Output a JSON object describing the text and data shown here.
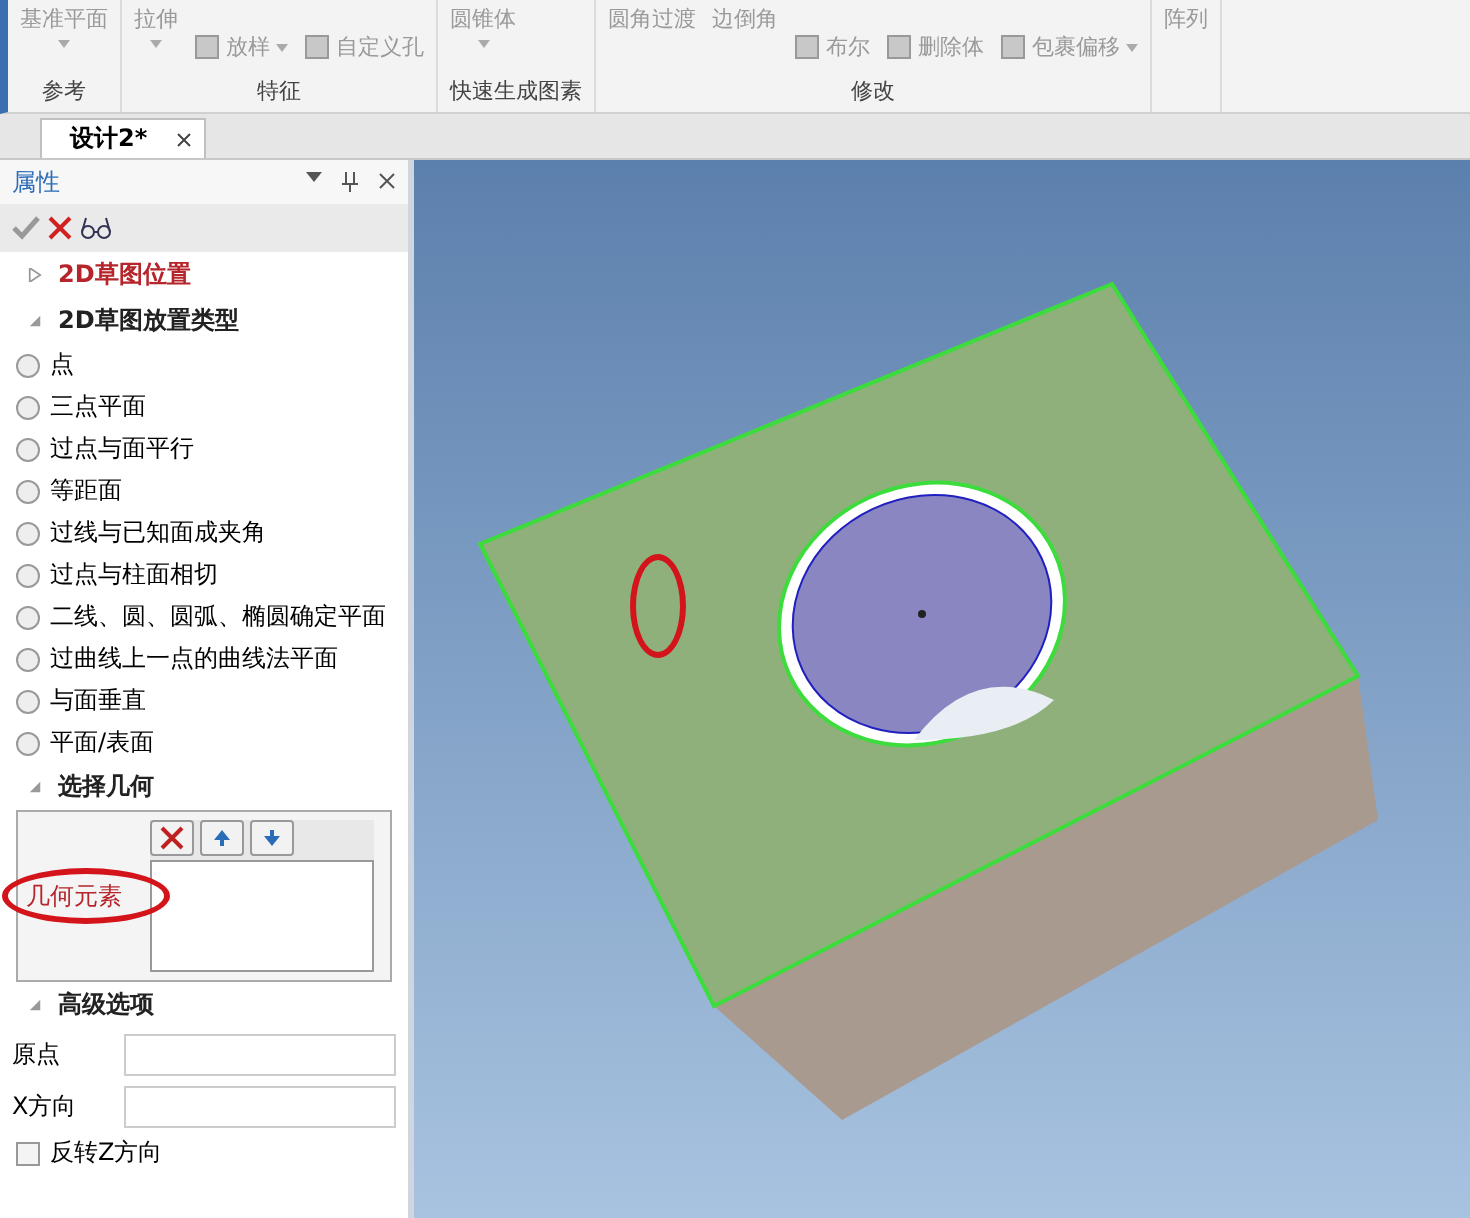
{
  "ribbon": {
    "groups": [
      {
        "label": "参考",
        "items": [
          {
            "label": "基准平面",
            "kind": "large"
          }
        ]
      },
      {
        "label": "特征",
        "items": [
          {
            "label": "拉伸",
            "kind": "large"
          },
          {
            "label": "放样",
            "kind": "small",
            "dropdown": true
          },
          {
            "label": "自定义孔",
            "kind": "small",
            "dropdown": false
          }
        ]
      },
      {
        "label": "快速生成图素",
        "items": [
          {
            "label": "圆锥体",
            "kind": "large"
          }
        ]
      },
      {
        "label": "修改",
        "items": [
          {
            "label": "圆角过渡",
            "kind": "text"
          },
          {
            "label": "边倒角",
            "kind": "text"
          },
          {
            "label": "布尔",
            "kind": "small",
            "dropdown": false
          },
          {
            "label": "删除体",
            "kind": "small",
            "dropdown": false
          },
          {
            "label": "包裹偏移",
            "kind": "small",
            "dropdown": true
          }
        ]
      },
      {
        "items": [
          {
            "label": "阵列",
            "kind": "text"
          }
        ]
      }
    ]
  },
  "tabs": [
    {
      "label": "设计2*",
      "selected": true
    }
  ],
  "panel": {
    "title": "属性",
    "sections": [
      {
        "title": "2D草图位置",
        "expanded": false,
        "required": true
      },
      {
        "title": "2D草图放置类型",
        "expanded": true,
        "required": false,
        "options": [
          {
            "label": "点",
            "selected": false
          },
          {
            "label": "三点平面",
            "selected": false
          },
          {
            "label": "过点与面平行",
            "selected": false
          },
          {
            "label": "等距面",
            "selected": false
          },
          {
            "label": "过线与已知面成夹角",
            "selected": false
          },
          {
            "label": "过点与柱面相切",
            "selected": false
          },
          {
            "label": "二线、圆、圆弧、椭圆确定平面",
            "selected": false
          },
          {
            "label": "过曲线上一点的曲线法平面",
            "selected": false
          },
          {
            "label": "与面垂直",
            "selected": false
          },
          {
            "label": "平面/表面",
            "selected": false
          }
        ]
      },
      {
        "title": "选择几何",
        "expanded": true,
        "required": false,
        "geometry_label": "几何元素"
      },
      {
        "title": "高级选项",
        "expanded": true,
        "required": false,
        "fields": [
          {
            "label": "原点"
          },
          {
            "label": "X方向"
          }
        ],
        "checkboxes": [
          {
            "label": "反转Z方向",
            "checked": false
          }
        ]
      }
    ]
  }
}
